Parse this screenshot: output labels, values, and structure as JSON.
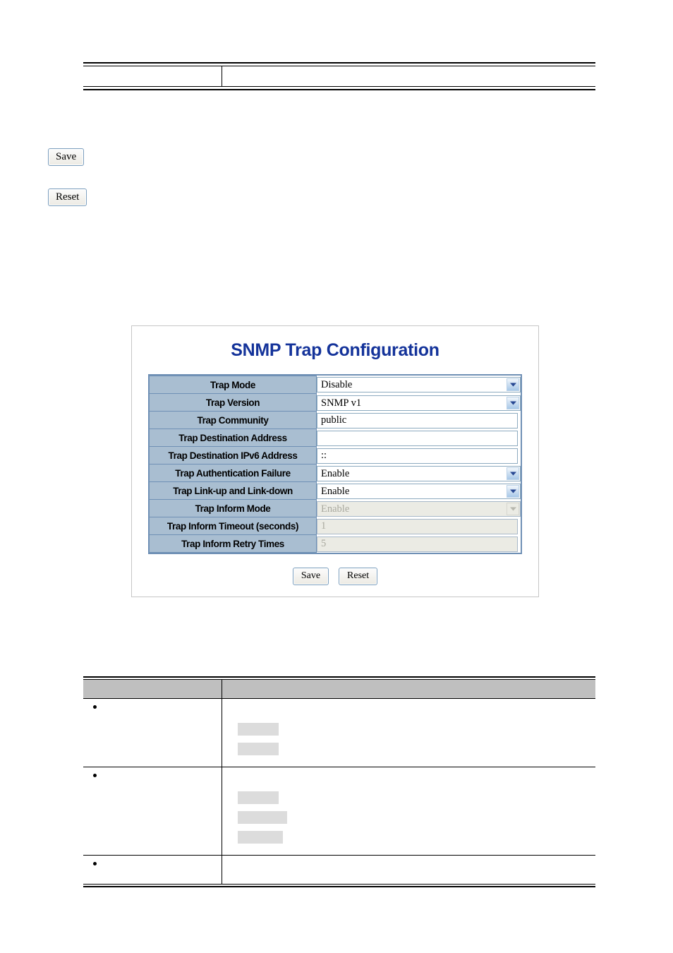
{
  "document": {
    "top_table": {
      "rows": [
        {
          "left": "",
          "right": ""
        }
      ]
    },
    "bottom_table": {
      "headers": {
        "left": "",
        "right": ""
      },
      "rows": [
        {
          "bullet": true,
          "label": "",
          "description": "",
          "redacted_blocks": [
            "",
            ""
          ]
        },
        {
          "bullet": true,
          "label": "",
          "description": "",
          "redacted_blocks": [
            "",
            "",
            ""
          ]
        },
        {
          "bullet": true,
          "label": "",
          "description": "",
          "redacted_blocks": []
        }
      ]
    }
  },
  "page_buttons": {
    "save_label": "Save",
    "reset_label": "Reset"
  },
  "snmp_panel": {
    "title": "SNMP Trap Configuration",
    "accent_color": "#14339a",
    "label_bg_color": "#a9bed1",
    "border_color": "#6f90b5",
    "fields": [
      {
        "name": "trap-mode",
        "label": "Trap Mode",
        "control": "select",
        "value": "Disable",
        "disabled": false
      },
      {
        "name": "trap-version",
        "label": "Trap Version",
        "control": "select",
        "value": "SNMP v1",
        "disabled": false
      },
      {
        "name": "trap-community",
        "label": "Trap Community",
        "control": "text",
        "value": "public",
        "disabled": false
      },
      {
        "name": "trap-destination-address",
        "label": "Trap Destination Address",
        "control": "text",
        "value": "",
        "disabled": false
      },
      {
        "name": "trap-destination-ipv6-address",
        "label": "Trap Destination IPv6 Address",
        "control": "text",
        "value": "::",
        "disabled": false
      },
      {
        "name": "trap-authentication-failure",
        "label": "Trap Authentication Failure",
        "control": "select",
        "value": "Enable",
        "disabled": false
      },
      {
        "name": "trap-link-up-and-link-down",
        "label": "Trap Link-up and Link-down",
        "control": "select",
        "value": "Enable",
        "disabled": false
      },
      {
        "name": "trap-inform-mode",
        "label": "Trap Inform Mode",
        "control": "select",
        "value": "Enable",
        "disabled": true
      },
      {
        "name": "trap-inform-timeout-seconds",
        "label": "Trap Inform Timeout (seconds)",
        "control": "text",
        "value": "1",
        "disabled": true
      },
      {
        "name": "trap-inform-retry-times",
        "label": "Trap Inform Retry Times",
        "control": "text",
        "value": "5",
        "disabled": true
      }
    ],
    "actions": {
      "save_label": "Save",
      "reset_label": "Reset"
    }
  }
}
